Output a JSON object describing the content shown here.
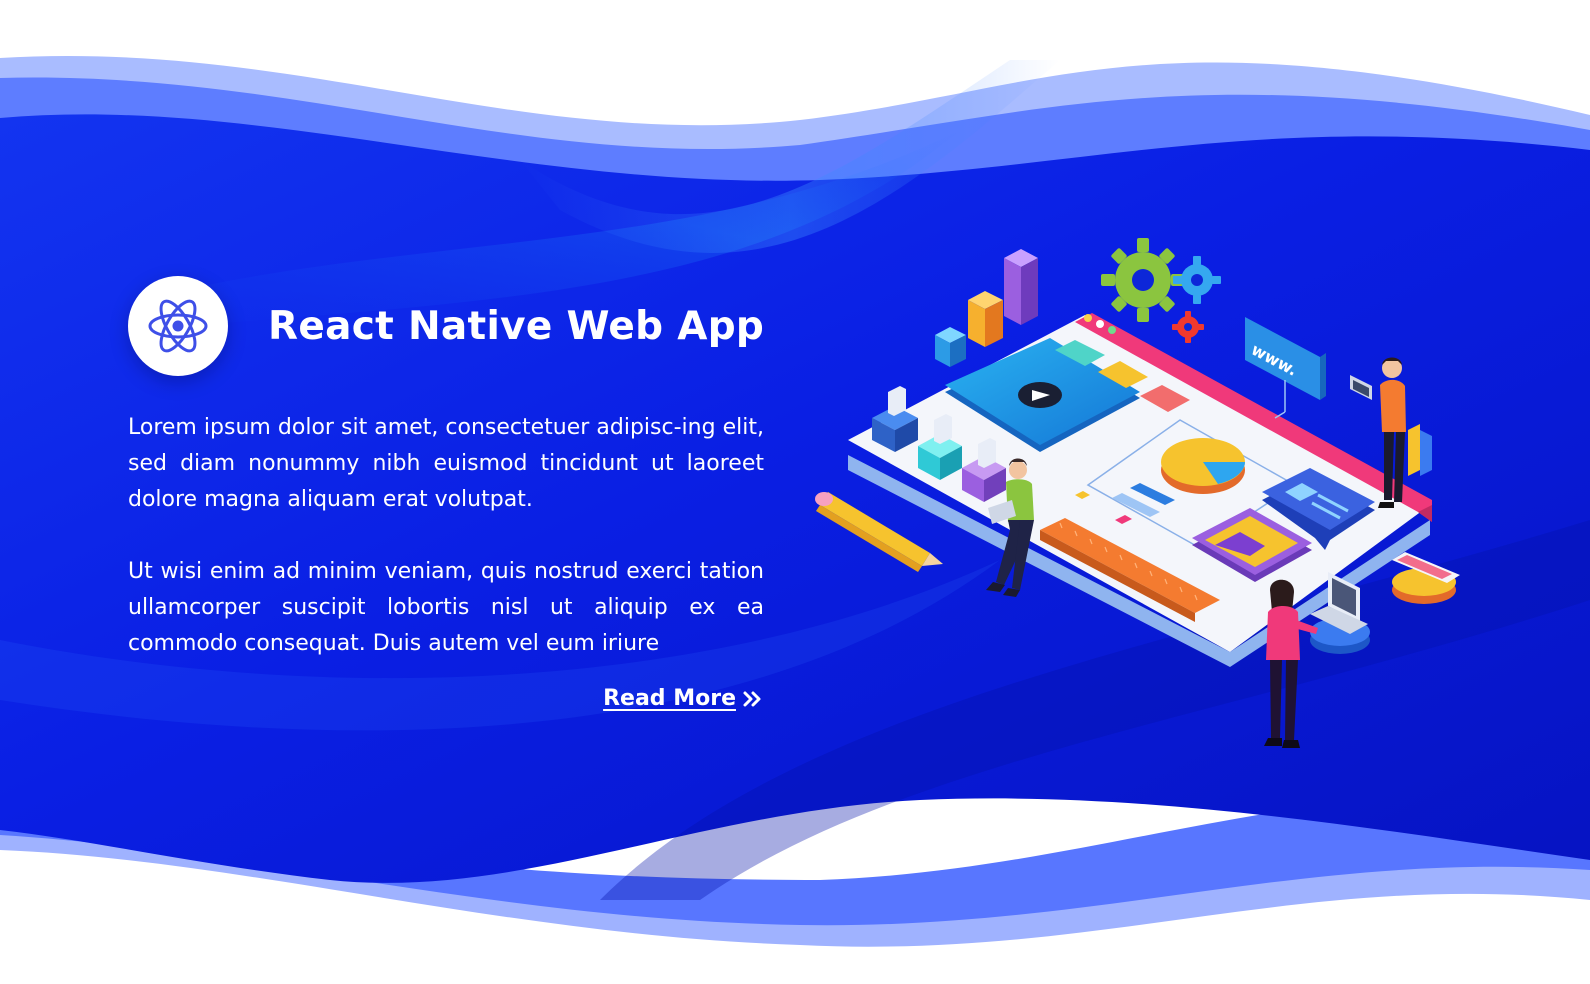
{
  "hero": {
    "icon": "react-atom-icon",
    "title": "React Native Web App",
    "paragraph_1": "Lorem ipsum dolor sit amet, consectetuer adipisc-ing elit, sed diam nonummy nibh euismod tincidunt ut laoreet dolore magna aliquam erat volutpat.",
    "paragraph_2": "Ut wisi enim ad minim veniam, quis nostrud exerci tation ullamcorper suscipit lobortis nisl ut aliquip ex ea commodo consequat. Duis autem vel eum iriure",
    "read_more_label": "Read More",
    "read_more_icon": "double-chevron-right-icon"
  },
  "illustration": {
    "window_label": "www.",
    "icons": [
      "gear-icon",
      "play-icon",
      "pie-chart-icon",
      "bar-chart-icon",
      "pencil-icon",
      "ruler-icon",
      "image-icon",
      "laptop-icon",
      "phone-icon"
    ]
  },
  "colors": {
    "background_blue": "#0b1fe0",
    "wave_light": "#8ea7ff",
    "accent_pink": "#f0397a",
    "accent_orange": "#f47b30",
    "accent_purple": "#8b52d6",
    "accent_yellow": "#f6c32e",
    "accent_green": "#8bc53f"
  }
}
